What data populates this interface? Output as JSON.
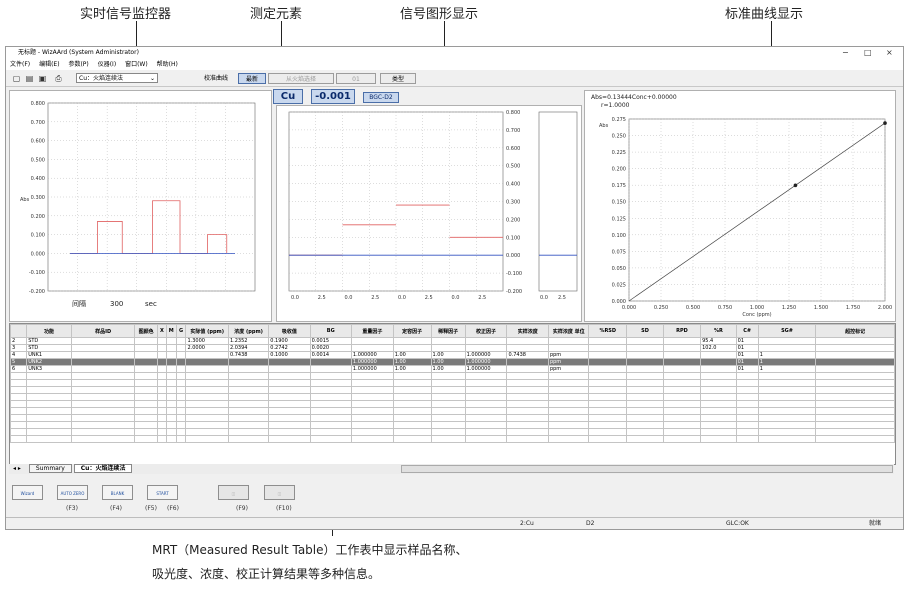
{
  "annotations": {
    "monitor": "实时信号监控器",
    "element": "测定元素",
    "signal": "信号图形显示",
    "curve": "标准曲线显示",
    "caption_line1": "MRT（Measured Result Table）工作表中显示样品名称、",
    "caption_line2": "吸光度、浓度、校正计算结果等多种信息。"
  },
  "window": {
    "title": "无标题 - WizAArd (System Administrator)",
    "menu": [
      "文件(F)",
      "编辑(E)",
      "参数(P)",
      "仪器(I)",
      "窗口(W)",
      "帮助(H)"
    ],
    "controls": [
      "−",
      "□",
      "×"
    ]
  },
  "toolbar": {
    "icons": [
      "new-icon",
      "open-icon",
      "save-icon",
      "print-icon"
    ],
    "element_combo": "Cu：火焰连续法",
    "buttons": [
      "校准曲线",
      "最新",
      "从火焰选择",
      "01",
      "类型"
    ]
  },
  "readout": {
    "element": "Cu",
    "value": "-0.001",
    "bgc": "BGC-D2"
  },
  "monitor": {
    "ylabel": "Abs",
    "yticks": [
      "0.800",
      "0.700",
      "0.600",
      "0.500",
      "0.400",
      "0.300",
      "0.200",
      "0.100",
      "0.000",
      "-0.100",
      "-0.200"
    ],
    "interval_label": "间隔",
    "interval_value": "300",
    "interval_unit": "sec"
  },
  "signal": {
    "yticks": [
      "0.800",
      "0.700",
      "0.600",
      "0.500",
      "0.400",
      "0.300",
      "0.200",
      "0.100",
      "0.000",
      "-0.100",
      "-0.200"
    ],
    "xticks": [
      "0.0",
      "2.5",
      "0.0",
      "2.5",
      "0.0",
      "2.5",
      "0.0",
      "2.5"
    ],
    "right_xticks": [
      "0.0",
      "2.5"
    ]
  },
  "curve": {
    "equation": "Abs=0.13444Conc+0.00000",
    "r": "r=1.0000",
    "ylabel": "Abs",
    "xlabel": "Conc (ppm)",
    "yticks": [
      "0.275",
      "0.250",
      "0.225",
      "0.200",
      "0.175",
      "0.150",
      "0.125",
      "0.100",
      "0.075",
      "0.050",
      "0.025",
      "0.000"
    ],
    "xticks": [
      "0.000",
      "0.250",
      "0.500",
      "0.750",
      "1.000",
      "1.250",
      "1.500",
      "1.750",
      "2.000"
    ]
  },
  "chart_data": [
    {
      "type": "line",
      "ylim": [
        -0.2,
        0.8
      ],
      "series": [
        {
          "color": "#e06060",
          "points": [
            [
              0.0,
              0.0
            ],
            [
              0.5,
              0.17
            ],
            [
              0.95,
              0.0
            ],
            [
              1.5,
              0.28
            ],
            [
              2.0,
              0.0
            ],
            [
              2.5,
              0.1
            ],
            [
              2.85,
              0.0
            ]
          ]
        },
        {
          "color": "#3050c0",
          "points": [
            [
              0.0,
              0.0
            ],
            [
              3.0,
              0.0
            ]
          ]
        }
      ]
    },
    {
      "type": "line",
      "ylim": [
        -0.2,
        0.8
      ],
      "series": [
        {
          "color": "#e06060",
          "steps": [
            [
              0,
              0.0
            ],
            [
              1,
              0.17
            ],
            [
              2,
              0.28
            ],
            [
              3,
              0.1
            ]
          ]
        },
        {
          "color": "#3050c0",
          "steps": [
            [
              0,
              0.0
            ],
            [
              1,
              0.0
            ],
            [
              2,
              0.0
            ],
            [
              3,
              0.0
            ]
          ]
        }
      ]
    },
    {
      "type": "scatter",
      "xlabel": "Conc (ppm)",
      "ylabel": "Abs",
      "xlim": [
        0,
        2.0
      ],
      "ylim": [
        0,
        0.275
      ],
      "points": [
        [
          1.3,
          0.1748
        ],
        [
          2.0,
          0.2688
        ]
      ],
      "fit": {
        "slope": 0.13444,
        "intercept": 0.0
      }
    }
  ],
  "mrt": {
    "headers": [
      "",
      "功能",
      "样品ID",
      "图颜色",
      "X",
      "M",
      "G",
      "实际值\n(ppm)",
      "浓度\n(ppm)",
      "吸收值",
      "BG",
      "重量因子",
      "定容因子",
      "稀释因子",
      "校正因子",
      "实样浓度",
      "实样浓度\n单位",
      "%RSD",
      "SD",
      "RPD",
      "%R",
      "C#",
      "SG#",
      "超控标记"
    ],
    "rows": [
      [
        "2",
        "STD",
        "",
        "",
        "",
        "",
        "",
        "1.3000",
        "1.2352",
        "0.1900",
        "0.0015",
        "",
        "",
        "",
        "",
        "",
        "",
        "",
        "",
        "",
        "95.4",
        "01",
        "",
        ""
      ],
      [
        "3",
        "STD",
        "",
        "",
        "",
        "",
        "",
        "2.0000",
        "2.0394",
        "0.2742",
        "0.0020",
        "",
        "",
        "",
        "",
        "",
        "",
        "",
        "",
        "",
        "102.0",
        "01",
        "",
        ""
      ],
      [
        "4",
        "UNK1",
        "",
        "",
        "",
        "",
        "",
        "",
        "0.7438",
        "0.1000",
        "0.0014",
        "1.000000",
        "1.00",
        "1.00",
        "1.000000",
        "0.7438",
        "ppm",
        "",
        "",
        "",
        "",
        "01",
        "1",
        ""
      ],
      [
        "5",
        "UNK2",
        "",
        "",
        "",
        "",
        "",
        "",
        "",
        "",
        "",
        "1.000000",
        "1.00",
        "1.00",
        "1.000000",
        "",
        "ppm",
        "",
        "",
        "",
        "",
        "01",
        "1",
        ""
      ],
      [
        "6",
        "UNK3",
        "",
        "",
        "",
        "",
        "",
        "",
        "",
        "",
        "",
        "1.000000",
        "1.00",
        "1.00",
        "1.000000",
        "",
        "ppm",
        "",
        "",
        "",
        "",
        "01",
        "1",
        ""
      ]
    ],
    "tabs": [
      "Summary",
      "Cu：火焰连续法"
    ]
  },
  "buttons": [
    {
      "label": "Wizard",
      "key": "(F3)"
    },
    {
      "label": "AUTO ZERO",
      "key": "(F4)"
    },
    {
      "label": "BLANK",
      "key": "(F5)"
    },
    {
      "label": "START",
      "key": "(F6)"
    },
    {
      "label": "",
      "key": "(F9)"
    },
    {
      "label": "",
      "key": "(F10)"
    }
  ],
  "status": [
    "2:Cu",
    "D2",
    "GLC:OK",
    "就绪"
  ]
}
